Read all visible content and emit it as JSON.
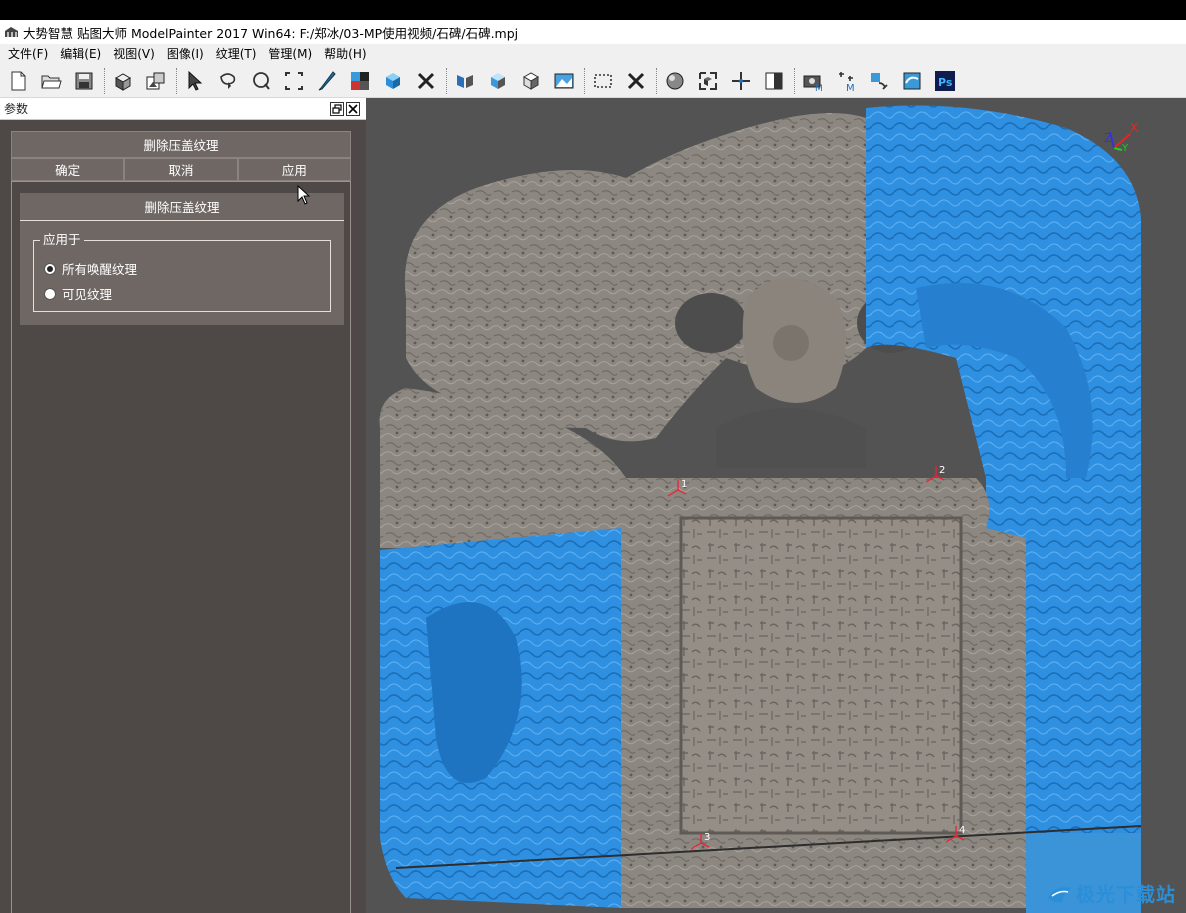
{
  "window": {
    "title": "大势智慧 贴图大师 ModelPainter 2017 Win64: F:/郑冰/03-MP使用视频/石碑/石碑.mpj"
  },
  "menu": [
    {
      "label": "文件(F)"
    },
    {
      "label": "编辑(E)"
    },
    {
      "label": "视图(V)"
    },
    {
      "label": "图像(I)"
    },
    {
      "label": "纹理(T)"
    },
    {
      "label": "管理(M)"
    },
    {
      "label": "帮助(H)"
    }
  ],
  "toolbar_icons": [
    "new-file-icon",
    "open-folder-icon",
    "save-icon",
    "|",
    "import-model-icon",
    "export-image-icon",
    "|",
    "select-arrow-icon",
    "lasso-select-icon",
    "circle-select-icon",
    "rect-select-icon",
    "brush-icon",
    "texture-tile-icon",
    "cube-color-icon",
    "cross-icon",
    "|",
    "mirror-model-icon",
    "cube-blue-icon",
    "cube-white-icon",
    "image-view-icon",
    "|",
    "dashed-rect-icon",
    "close-x-icon",
    "|",
    "sphere-icon",
    "cube-frame-icon",
    "move-points-icon",
    "gradient-icon",
    "|",
    "camera-m-icon",
    "points-m-icon",
    "image-sync-icon",
    "photo-swap-icon",
    "photoshop-icon"
  ],
  "panel": {
    "title": "参数",
    "command_title": "删除压盖纹理",
    "buttons": {
      "ok": "确定",
      "cancel": "取消",
      "apply": "应用"
    },
    "section_title": "删除压盖纹理",
    "group_label": "应用于",
    "options": [
      {
        "label": "所有唤醒纹理",
        "selected": true
      },
      {
        "label": "可见纹理",
        "selected": false
      }
    ]
  },
  "viewport": {
    "axis": {
      "x": "X",
      "y": "Y",
      "z": "Z"
    },
    "markers": [
      "1",
      "2",
      "3",
      "4"
    ],
    "watermark": "极光下载站"
  },
  "colors": {
    "stone": "#8c8780",
    "blue_texture": "#2f8fe0",
    "viewport_bg": "#535353",
    "panel_bg": "#4e4846"
  }
}
